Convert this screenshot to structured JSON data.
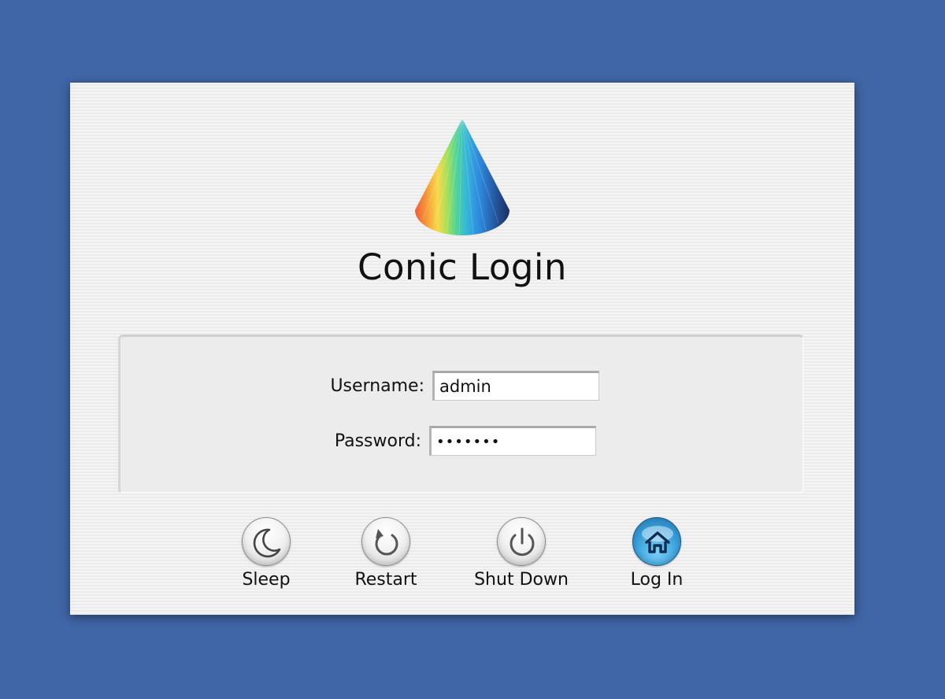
{
  "app": {
    "title": "Conic Login",
    "logo_icon": "rainbow-cone-logo"
  },
  "form": {
    "username_label": "Username:",
    "username_value": "admin",
    "password_label": "Password:",
    "password_value": "•••••••"
  },
  "actions": [
    {
      "label": "Sleep",
      "icon": "moon-icon"
    },
    {
      "label": "Restart",
      "icon": "restart-icon"
    },
    {
      "label": "Shut Down",
      "icon": "power-icon"
    },
    {
      "label": "Log In",
      "icon": "home-icon"
    }
  ],
  "colors": {
    "desktop_background": "#4066a7",
    "panel_background": "#f1f1f1",
    "login_button": "#3aa2dc"
  }
}
